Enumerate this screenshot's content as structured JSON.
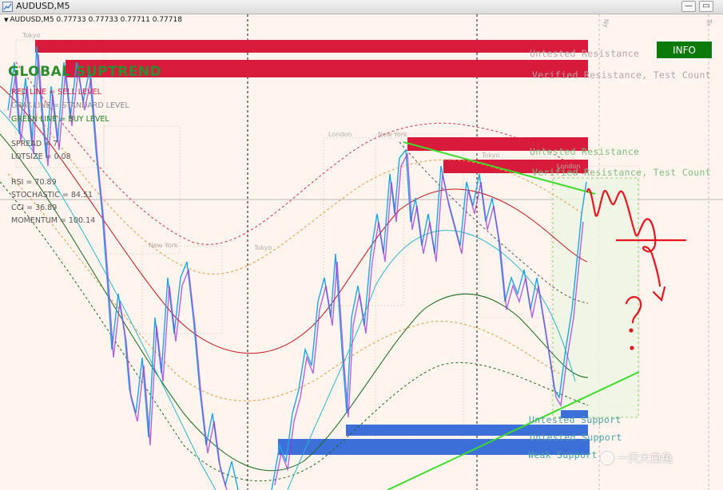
{
  "window": {
    "title": "AUDUSD,M5",
    "buttons": {
      "minimize": "—",
      "maximize": "▭"
    }
  },
  "chart_header": {
    "symbol_line": "AUDUSD,M5  0.77733 0.77733 0.77711 0.77718"
  },
  "indicator": {
    "name": "GLOBAL SUPTREND",
    "legend": [
      {
        "text": "RED LINE = SELL LEVEL",
        "color": "#d81b3c"
      },
      {
        "text": "GRAY LINE = STANDARD LEVEL",
        "color": "#8a8a8a"
      },
      {
        "text": "GREEN LINE = BUY LEVEL",
        "color": "#1a7f1a"
      }
    ],
    "stats": [
      "SPREAD = 7",
      "LOTSIZE = 0.08",
      "RSI = 70.89",
      "STOCHASTIC = 84.51",
      "CCI = 36.89",
      "MOMENTUM = 100.14"
    ]
  },
  "info_button": {
    "label": "INFO"
  },
  "zones": {
    "resistance": [
      {
        "label": "Untested Resistance",
        "style": "red"
      },
      {
        "label": "Verified Resistance, Test Count",
        "style": "red"
      },
      {
        "label": "Untested Resistance",
        "style": "green"
      },
      {
        "label": "Verified Resistance, Test Count",
        "style": "green"
      }
    ],
    "support": [
      {
        "label": "Untested Support"
      },
      {
        "label": "Untested Support"
      },
      {
        "label": "Weak Support"
      }
    ]
  },
  "sessions": [
    "Tokyo",
    "New York",
    "Tokyo",
    "London",
    "New York",
    "Tokyo",
    "London"
  ],
  "top_marks": [
    "Ny",
    "To"
  ],
  "annotation": {
    "question_mark": "?"
  },
  "watermark": {
    "text": "一只大白兔"
  },
  "colors": {
    "chart_bg": "#fff4ee",
    "resistance_zone": "#d81b3c",
    "support_zone": "#3c6fd8",
    "candles_up": "#1aa6e6",
    "candles_down": "#9b32d8",
    "trendline": "#3ddc2a",
    "info_button": "#0b7a0b",
    "annotation": "#e8141e"
  }
}
